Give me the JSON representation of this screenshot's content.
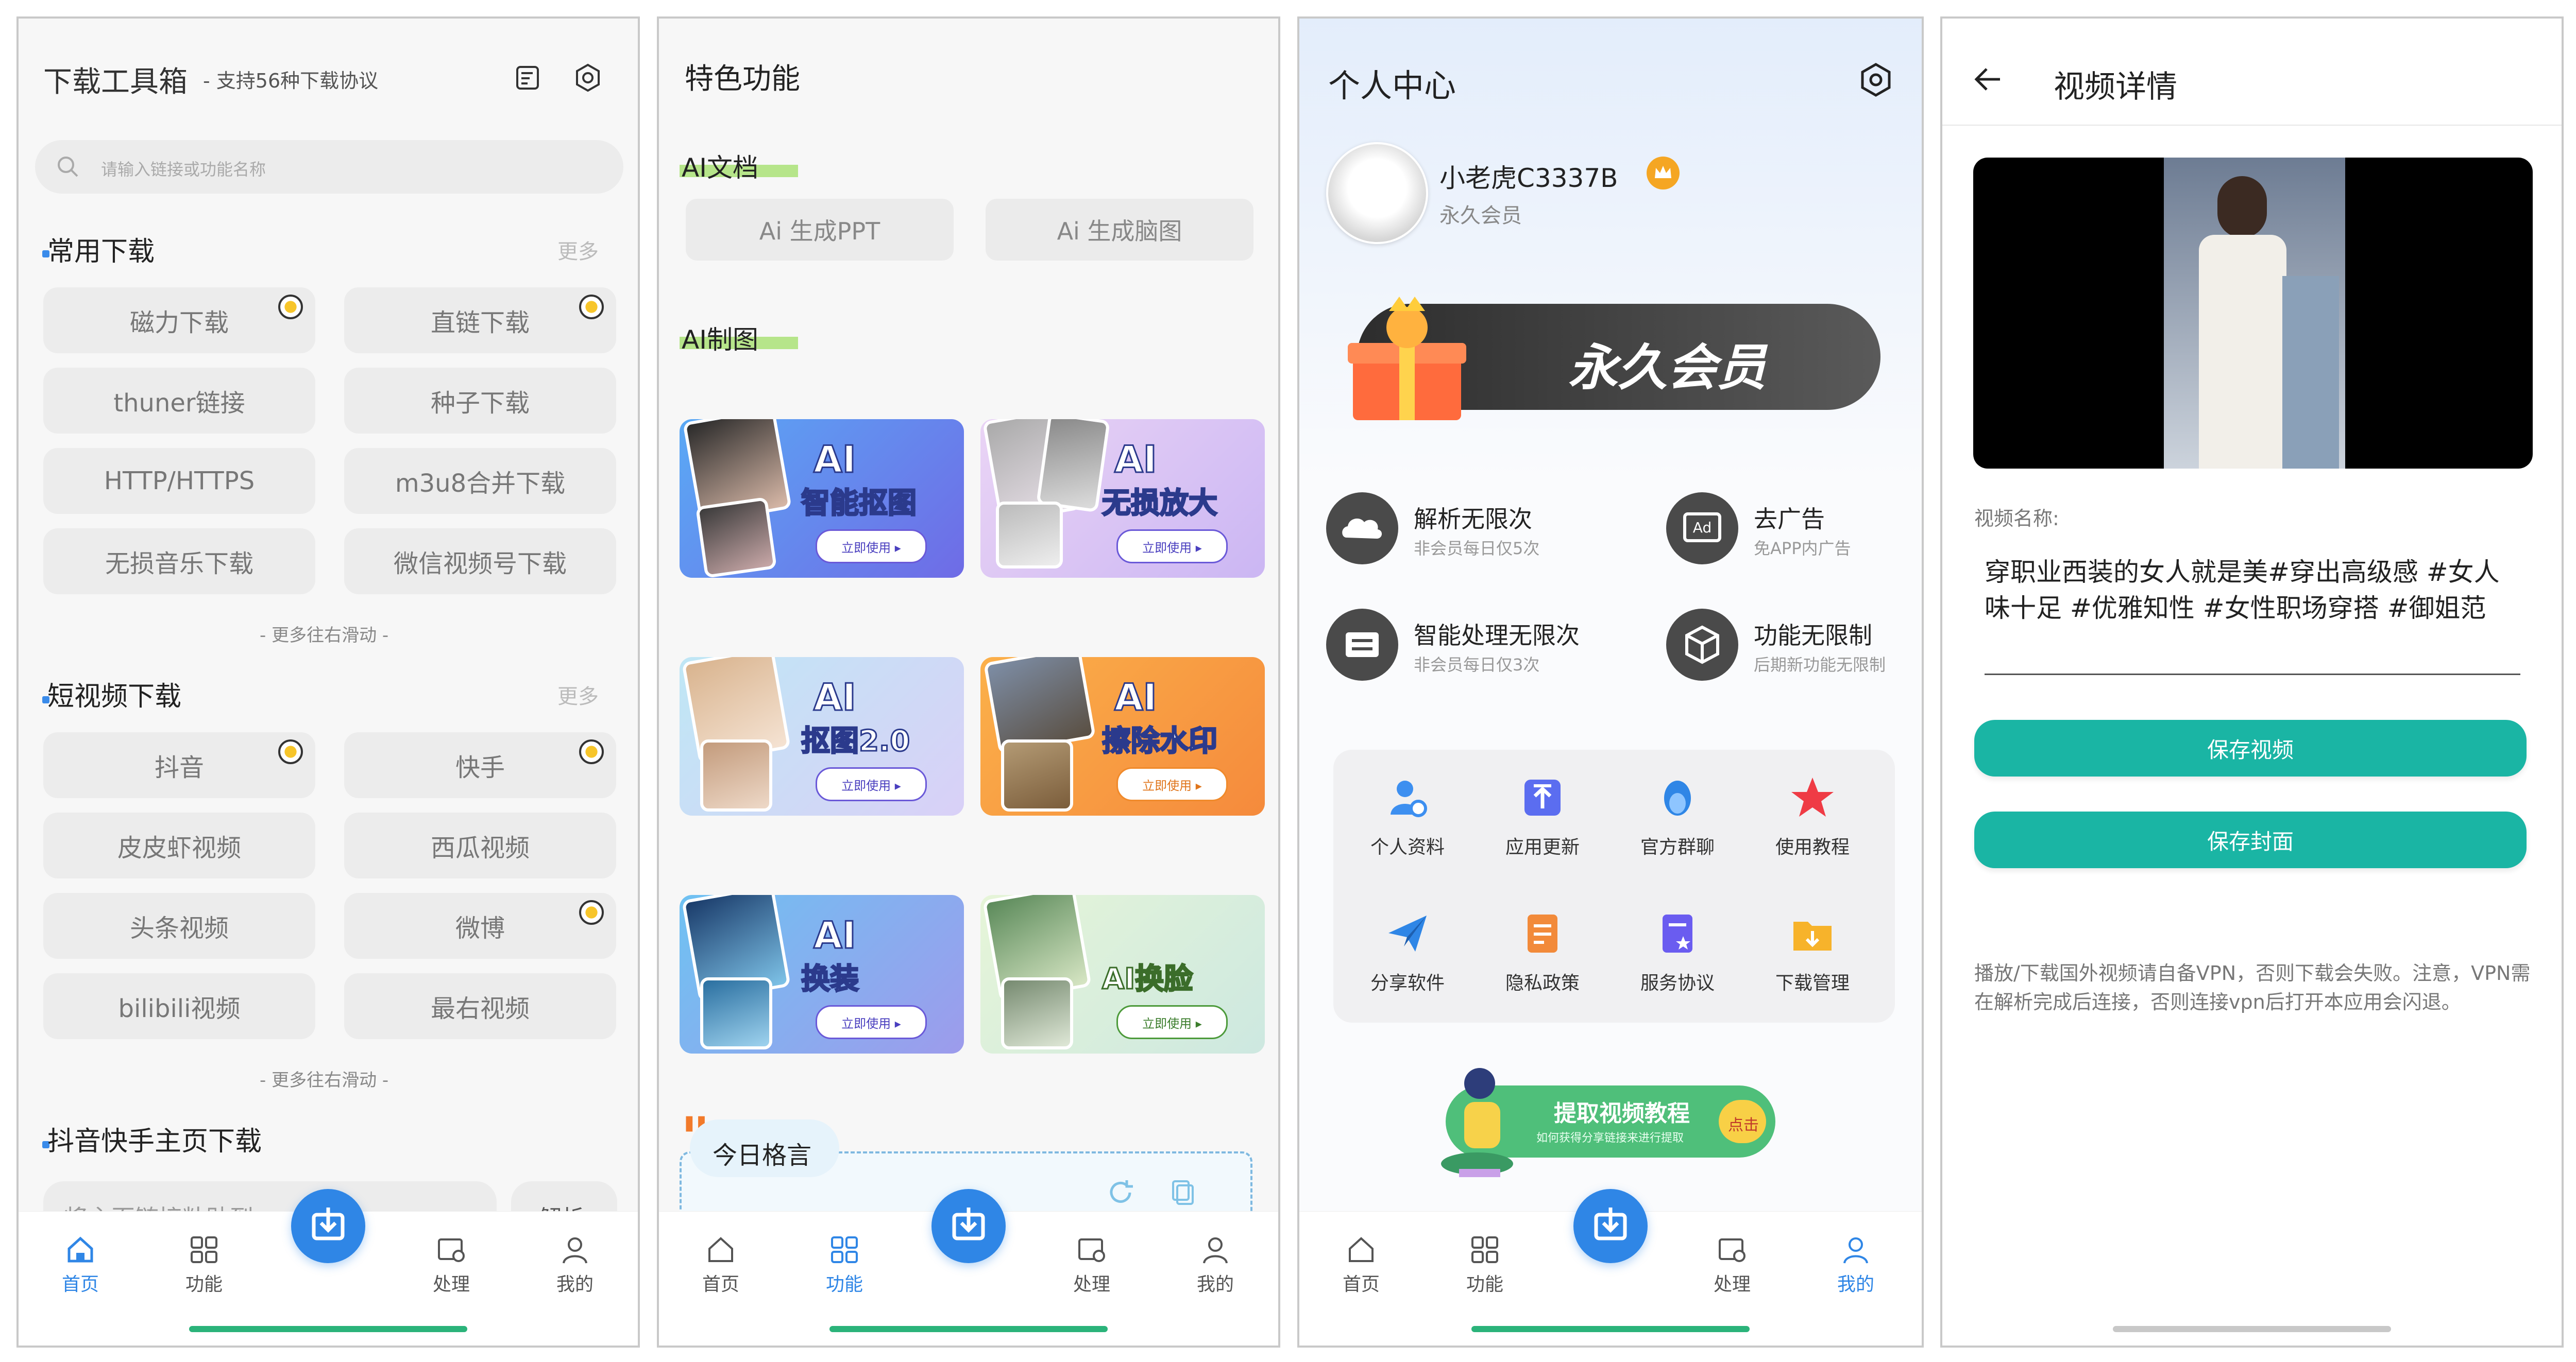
{
  "p1": {
    "title": "下载工具箱",
    "subtitle": "- 支持56种下载协议",
    "search_placeholder": "请输入链接或功能名称",
    "sections": {
      "common": {
        "title": "常用下载",
        "more": "更多",
        "items": [
          "磁力下载",
          "直链下载",
          "thuner链接",
          "种子下载",
          "HTTP/HTTPS",
          "m3u8合并下载",
          "无损音乐下载",
          "微信视频号下载"
        ],
        "hint": "- 更多往右滑动 -"
      },
      "short": {
        "title": "短视频下载",
        "more": "更多",
        "items": [
          "抖音",
          "快手",
          "皮皮虾视频",
          "西瓜视频",
          "头条视频",
          "微博",
          "bilibili视频",
          "最右视频"
        ],
        "hint": "- 更多往右滑动 -"
      },
      "homepage": {
        "title": "抖音快手主页下载",
        "input_text": "将主页链接粘贴到",
        "parse": "解析"
      }
    }
  },
  "p2": {
    "title": "特色功能",
    "ai_doc": "AI文档",
    "ai_doc_items": [
      "Ai 生成PPT",
      "Ai 生成脑图"
    ],
    "ai_draw": "AI制图",
    "cards": [
      {
        "t1": "AI",
        "t2": "智能抠图",
        "use": "立即使用 ▸"
      },
      {
        "t1": "AI",
        "t2": "无损放大",
        "use": "立即使用 ▸"
      },
      {
        "t1": "AI",
        "t2": "抠图2.0",
        "use": "立即使用 ▸"
      },
      {
        "t1": "AI",
        "t2": "擦除水印",
        "use": "立即使用 ▸"
      },
      {
        "t1": "AI",
        "t2": "换装",
        "use": "立即使用 ▸"
      },
      {
        "t1": "",
        "t2": "AI换脸",
        "use": "立即使用 ▸"
      }
    ],
    "quote_title": "今日格言"
  },
  "p3": {
    "title": "个人中心",
    "username": "小老虎C3337B",
    "member": "永久会员",
    "banner_text": "永久会员",
    "perks": [
      {
        "title": "解析无限次",
        "sub": "非会员每日仅5次"
      },
      {
        "title": "去广告",
        "sub": "免APP内广告"
      },
      {
        "title": "智能处理无限次",
        "sub": "非会员每日仅3次"
      },
      {
        "title": "功能无限制",
        "sub": "后期新功能无限制"
      }
    ],
    "grid": [
      "个人资料",
      "应用更新",
      "官方群聊",
      "使用教程",
      "分享软件",
      "隐私政策",
      "服务协议",
      "下载管理"
    ],
    "tutorial": {
      "title": "提取视频教程",
      "sub": "如何获得分享链接来进行提取",
      "cta": "点击"
    }
  },
  "p4": {
    "title": "视频详情",
    "name_label": "视频名称:",
    "video_title": "穿职业西装的女人就是美#穿出高级感 #女人味十足 #优雅知性 #女性职场穿搭 #御姐范",
    "save_video": "保存视频",
    "save_cover": "保存封面",
    "notice": "播放/下载国外视频请自备VPN，否则下载会失败。注意，VPN需在解析完成后连接，否则连接vpn后打开本应用会闪退。"
  },
  "nav": {
    "home": "首页",
    "func": "功能",
    "process": "处理",
    "mine": "我的"
  },
  "colors": {
    "accent": "#2f86e6",
    "teal": "#1ab5a4",
    "gold": "#f5a623"
  }
}
